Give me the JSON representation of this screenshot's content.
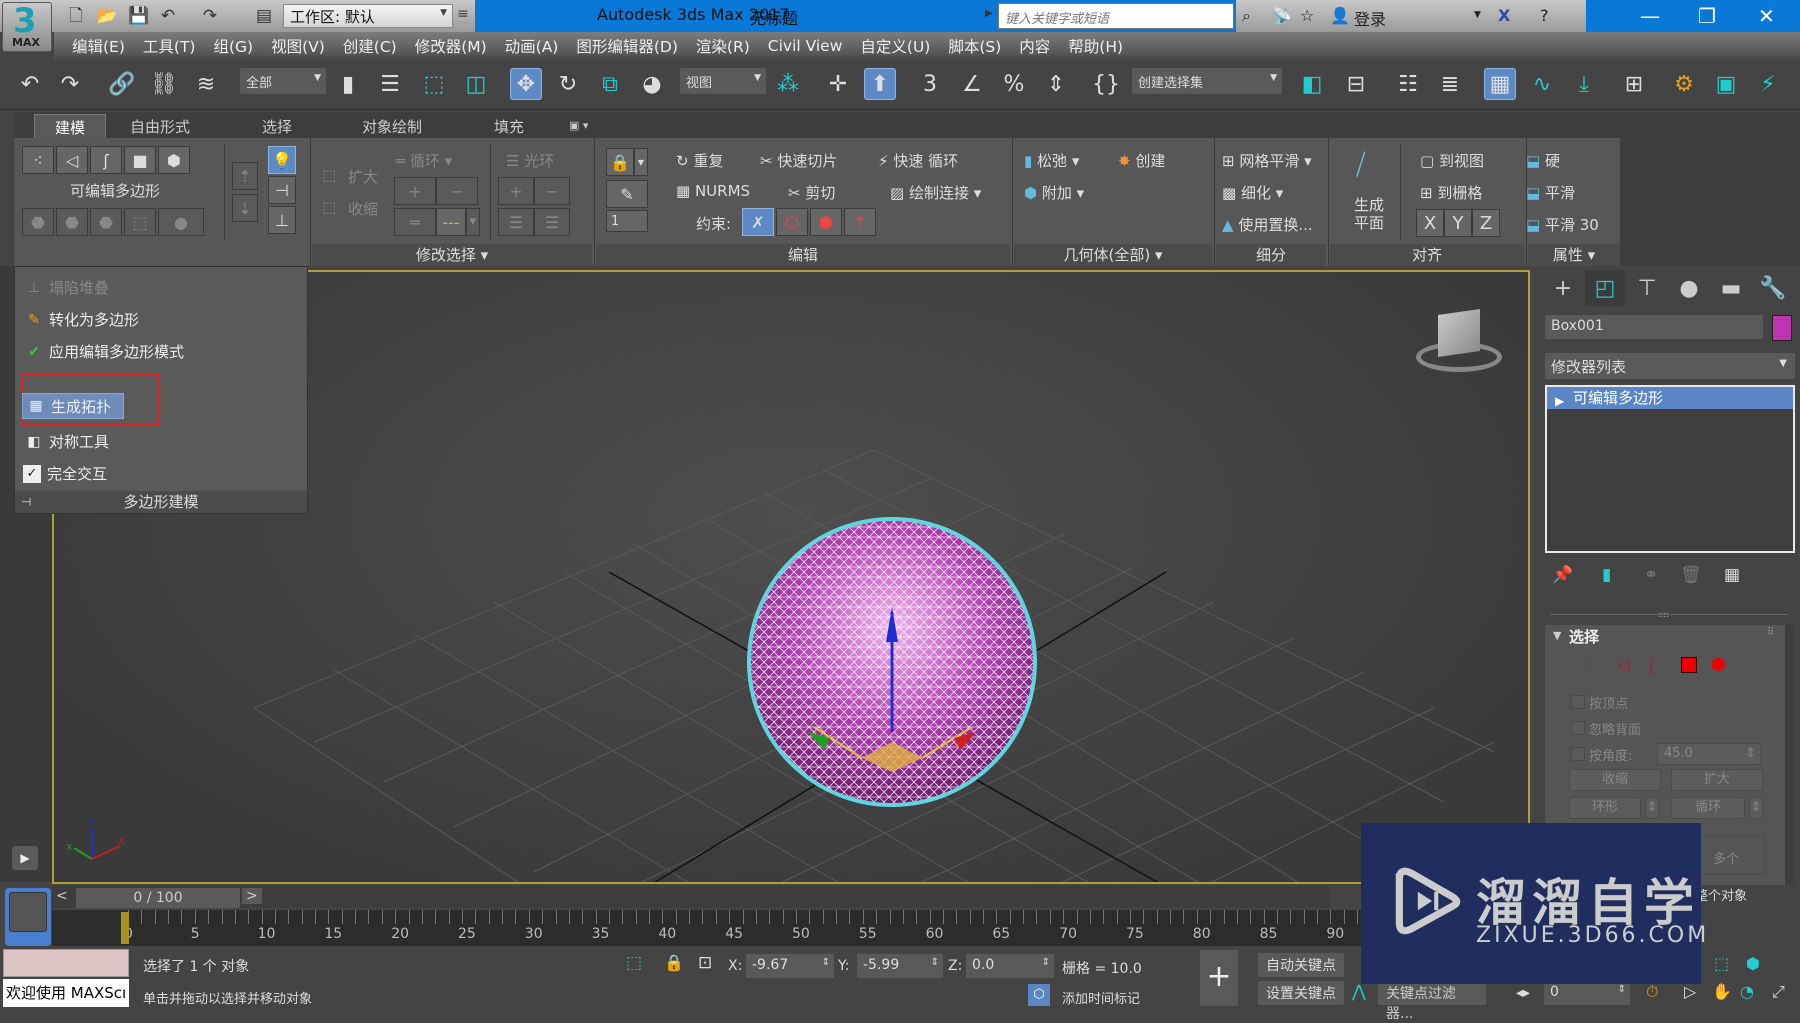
{
  "app": {
    "logo_number": "3",
    "logo_text": "MAX",
    "title": "Autodesk 3ds Max 2017",
    "document": "无标题",
    "workspace": "工作区: 默认",
    "search_placeholder": "键入关键字或短语",
    "login": "登录"
  },
  "menu": [
    "编辑(E)",
    "工具(T)",
    "组(G)",
    "视图(V)",
    "创建(C)",
    "修改器(M)",
    "动画(A)",
    "图形编辑器(D)",
    "渲染(R)",
    "Civil View",
    "自定义(U)",
    "脚本(S)",
    "内容",
    "帮助(H)"
  ],
  "toolbar": {
    "filter": "全部",
    "refcoord": "视图",
    "selection_set": "创建选择集"
  },
  "ribbon_tabs": [
    "建模",
    "自由形式",
    "选择",
    "对象绘制",
    "填充"
  ],
  "ribbon": {
    "poly_modeling": {
      "label": "可编辑多边形"
    },
    "modify_selection": {
      "grow": "扩大",
      "shrink": "收缩",
      "loop": "循环",
      "ring": "光环",
      "footer": "修改选择"
    },
    "edit": {
      "repeat": "重复",
      "quickslice": "快速切片",
      "swiftloop": "快速 循环",
      "nurms": "NURMS",
      "cut": "剪切",
      "paintconnect": "绘制连接",
      "constraints": "约束:",
      "spinner_value": "1",
      "footer": "编辑"
    },
    "geometry": {
      "relax": "松弛",
      "create": "创建",
      "attach": "附加",
      "footer": "几何体(全部)"
    },
    "subdivision": {
      "meshsmooth": "网格平滑",
      "tessellate": "细化",
      "usedisp": "使用置换...",
      "footer": "细分"
    },
    "align": {
      "makeplanar": "生成\n平面",
      "makeplanar1": "生成",
      "makeplanar2": "平面",
      "toview": "到视图",
      "togrid": "到栅格",
      "x": "X",
      "y": "Y",
      "z": "Z",
      "footer": "对齐"
    },
    "properties": {
      "hard": "硬",
      "smooth": "平滑",
      "smooth30": "平滑 30",
      "footer": "属性"
    }
  },
  "polypanel": {
    "items": [
      {
        "label": "塌陷堆叠",
        "enabled": false
      },
      {
        "label": "转化为多边形",
        "enabled": true
      },
      {
        "label": "应用编辑多边形模式",
        "enabled": true
      },
      {
        "label": "生成拓扑",
        "enabled": true,
        "highlighted": true
      },
      {
        "label": "对称工具",
        "enabled": true
      },
      {
        "label": "完全交互",
        "enabled": true,
        "checked": true
      }
    ],
    "footer": "多边形建模"
  },
  "cmdpanel": {
    "object_name": "Box001",
    "object_color": "#c034b4",
    "modifier_list": "修改器列表",
    "stack_item": "可编辑多边形",
    "rollout_title": "选择",
    "by_vertex": "按顶点",
    "ignore_backfacing": "忽略背面",
    "by_angle": "按角度:",
    "angle_value": "45.0",
    "shrink": "收缩",
    "grow": "扩大",
    "ring": "环形",
    "loop": "循环",
    "multiple": "多个",
    "whole_object": "整个对象"
  },
  "timeline": {
    "frame_display": "0 / 100",
    "current_frame": 0,
    "total_frames": 100,
    "ticks": [
      "0",
      "5",
      "10",
      "15",
      "20",
      "25",
      "30",
      "35",
      "40",
      "45",
      "50",
      "55",
      "60",
      "65",
      "70",
      "75",
      "80",
      "85",
      "90"
    ]
  },
  "status": {
    "selected": "选择了 1 个 对象",
    "prompt": "单击并拖动以选择并移动对象",
    "maxscript": "欢迎使用 MAXScı",
    "x_label": "X:",
    "x": "-9.67",
    "y_label": "Y:",
    "y": "-5.99",
    "z_label": "Z:",
    "z": "0.0",
    "grid": "栅格 = 10.0",
    "add_time_tag": "添加时间标记",
    "auto_key": "自动关键点",
    "set_key": "设置关键点",
    "key_filters": "关键点过滤器...",
    "frame_value": "0"
  },
  "watermark": {
    "title": "溜溜自学",
    "url": "ZIXUE.3D66.COM"
  }
}
